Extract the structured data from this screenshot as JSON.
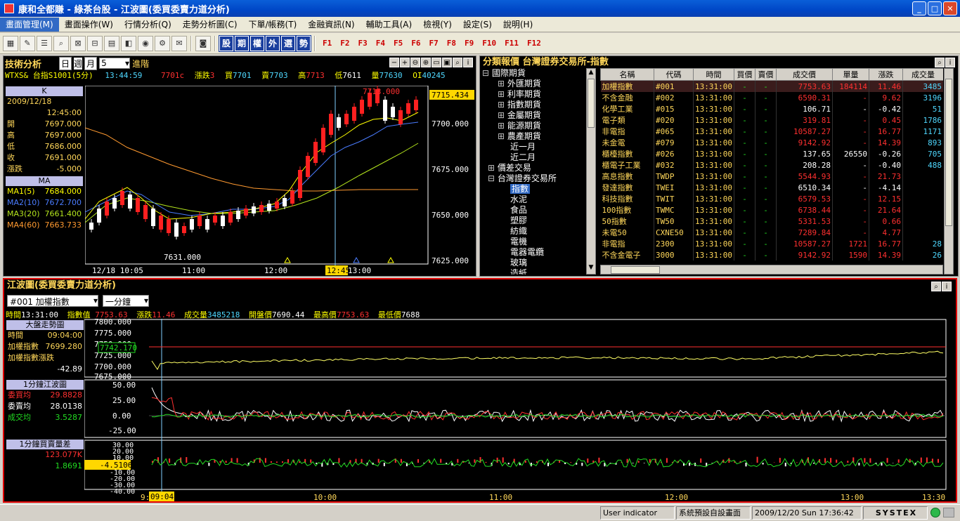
{
  "window": {
    "title": "康和全都賺 - 綠茶台股 - 江波圖(委買委賣力道分析)"
  },
  "menu": [
    "畫面管理(M)",
    "畫面操作(W)",
    "行情分析(Q)",
    "走勢分析圖(C)",
    "下單/帳務(T)",
    "金融資訊(N)",
    "輔助工具(A)",
    "檢視(Y)",
    "設定(S)",
    "說明(H)"
  ],
  "toolbar": {
    "keys": [
      "股",
      "期",
      "權",
      "外",
      "選",
      "勢"
    ],
    "fkeys": [
      "F1",
      "F2",
      "F3",
      "F4",
      "F5",
      "F6",
      "F7",
      "F8",
      "F9",
      "F10",
      "F11",
      "F12"
    ]
  },
  "tech": {
    "title": "技術分析",
    "period_sel": "日",
    "period_opts": "週",
    "period_month": "月",
    "count": "5",
    "advanced": "進階",
    "symbol": "WTXS& 台指S1001(5分)",
    "time": "13:44:59",
    "last": "7701c",
    "chg_label": "漲跌",
    "chg": "3",
    "bid_label": "買",
    "bid": "7701",
    "ask_label": "賣",
    "ask": "7703",
    "hi_label": "高",
    "hi": "7713",
    "lo_label": "低",
    "lo": "7611",
    "vol_label": "量",
    "vol": "77630",
    "oi_label": "OI",
    "oi": "40245",
    "k_head": "K",
    "date": "2009/12/18",
    "ktime": "12:45:00",
    "ohlc": [
      [
        "開",
        "7697.000"
      ],
      [
        "高",
        "7697.000"
      ],
      [
        "低",
        "7686.000"
      ],
      [
        "收",
        "7691.000"
      ],
      [
        "漲跌",
        "-5.000"
      ]
    ],
    "ma_head": "MA",
    "ma": [
      [
        "MA1(5)",
        "7684.000"
      ],
      [
        "MA2(10)",
        "7672.700"
      ],
      [
        "MA3(20)",
        "7661.400"
      ],
      [
        "MA4(60)",
        "7663.733"
      ]
    ],
    "yticks": [
      "7715.434",
      "7700.000",
      "7675.000",
      "7650.000",
      "7625.000"
    ],
    "xticks": [
      "12/18 10:05",
      "11:00",
      "12:00",
      "12:45",
      "13:00"
    ],
    "hi_note": "7713.000",
    "lo_note": "7631.000"
  },
  "quote": {
    "title": "分類報價 台灣證券交易所-指數",
    "tree": [
      "國際期貨",
      "外匯期貨",
      "利率期貨",
      "指數期貨",
      "金屬期貨",
      "能源期貨",
      "農產期貨",
      "近一月",
      "近二月",
      "價差交易",
      "台灣證券交易所",
      "指數",
      "水泥",
      "食品",
      "塑膠",
      "紡織",
      "電機",
      "電器電纜",
      "玻璃",
      "造紙",
      "鋼鐵"
    ],
    "cols": [
      "名稱",
      "代碼",
      "時間",
      "買價",
      "賣價",
      "成交價",
      "單量",
      "漲跌",
      "成交量"
    ],
    "rows": [
      [
        "加權指數",
        "#001",
        "13:31:00",
        "-",
        "-",
        "7753.63",
        "184114",
        "11.46",
        "3485"
      ],
      [
        "不含金融",
        "#002",
        "13:31:00",
        "-",
        "-",
        "6590.31",
        "-",
        "9.62",
        "3196"
      ],
      [
        "化學工業",
        "#015",
        "13:31:00",
        "-",
        "-",
        "106.71",
        "-",
        "-0.42",
        "51"
      ],
      [
        "電子類",
        "#020",
        "13:31:00",
        "-",
        "-",
        "319.81",
        "-",
        "0.45",
        "1786"
      ],
      [
        "非電指",
        "#065",
        "13:31:00",
        "-",
        "-",
        "10587.27",
        "-",
        "16.77",
        "1171"
      ],
      [
        "未金電",
        "#079",
        "13:31:00",
        "-",
        "-",
        "9142.92",
        "-",
        "14.39",
        "893"
      ],
      [
        "櫃檯指數",
        "#026",
        "13:31:00",
        "-",
        "-",
        "137.65",
        "26550",
        "-0.26",
        "705"
      ],
      [
        "櫃電子工業",
        "#032",
        "13:31:00",
        "-",
        "-",
        "208.28",
        "-",
        "-0.40",
        "488"
      ],
      [
        "高息指數",
        "TWDP",
        "13:31:00",
        "-",
        "-",
        "5544.93",
        "-",
        "21.73",
        ""
      ],
      [
        "發達指數",
        "TWEI",
        "13:31:00",
        "-",
        "-",
        "6510.34",
        "-",
        "-4.14",
        ""
      ],
      [
        "科技指數",
        "TWIT",
        "13:31:00",
        "-",
        "-",
        "6579.53",
        "-",
        "12.15",
        ""
      ],
      [
        "100指數",
        "TWMC",
        "13:31:00",
        "-",
        "-",
        "6738.44",
        "-",
        "21.64",
        ""
      ],
      [
        "50指數",
        "TW50",
        "13:31:00",
        "-",
        "-",
        "5331.53",
        "-",
        "0.66",
        ""
      ],
      [
        "未電50",
        "CXNE50",
        "13:31:00",
        "-",
        "-",
        "7289.84",
        "-",
        "4.77",
        ""
      ],
      [
        "非電指",
        "2300",
        "13:31:00",
        "-",
        "-",
        "10587.27",
        "1721",
        "16.77",
        "28"
      ],
      [
        "不含金電子",
        "3000",
        "13:31:00",
        "-",
        "-",
        "9142.92",
        "1590",
        "14.39",
        "26"
      ]
    ]
  },
  "wave": {
    "title": "江波圖(委買委賣力道分析)",
    "symbol_sel": "#001 加權指數",
    "interval_sel": "一分鐘",
    "info": [
      [
        "時間",
        "13:31:00"
      ],
      [
        "指數值",
        "7753.63"
      ],
      [
        "漲跌",
        "11.46"
      ],
      [
        "成交量",
        "3485218"
      ],
      [
        "開盤價",
        "7690.44"
      ],
      [
        "最高價",
        "7753.63"
      ],
      [
        "最低價",
        "7688"
      ]
    ],
    "p1": {
      "head": "大盤走勢圖",
      "time_label": "時間",
      "time": "09:04:00",
      "idx_label": "加權指數",
      "idx": "7699.280",
      "chg_label": "加權指數漲跌",
      "chg": "-42.89",
      "yticks": [
        "7800.000",
        "7775.000",
        "7750.000",
        "7725.000",
        "7700.000",
        "7675.000"
      ],
      "cursor_val": "7742.170"
    },
    "p2": {
      "head": "1分鐘江波圖",
      "rows": [
        [
          "委買均",
          "29.8828"
        ],
        [
          "委賣均",
          "28.0138"
        ],
        [
          "成交均",
          "3.5287"
        ]
      ],
      "yticks": [
        "50.00",
        "25.00",
        "0.00",
        "-25.00"
      ]
    },
    "p3": {
      "head": "1分鐘買賣量差",
      "v1": "123.077K",
      "v2": "1.8691",
      "cursor_val": "-4.5106",
      "yticks": [
        "30.00",
        "20.00",
        "10.00",
        "0.00",
        "-10.00",
        "-20.00",
        "-30.00",
        "-40.00"
      ]
    },
    "xticks": [
      "9:",
      "09:04",
      "10:00",
      "11:00",
      "12:00",
      "13:00",
      "13:30"
    ]
  },
  "status": {
    "indicator": "User indicator",
    "screen": "系統預設自設畫面",
    "datetime": "2009/12/20 Sun 17:36:42",
    "brand": "SYSTEX"
  }
}
